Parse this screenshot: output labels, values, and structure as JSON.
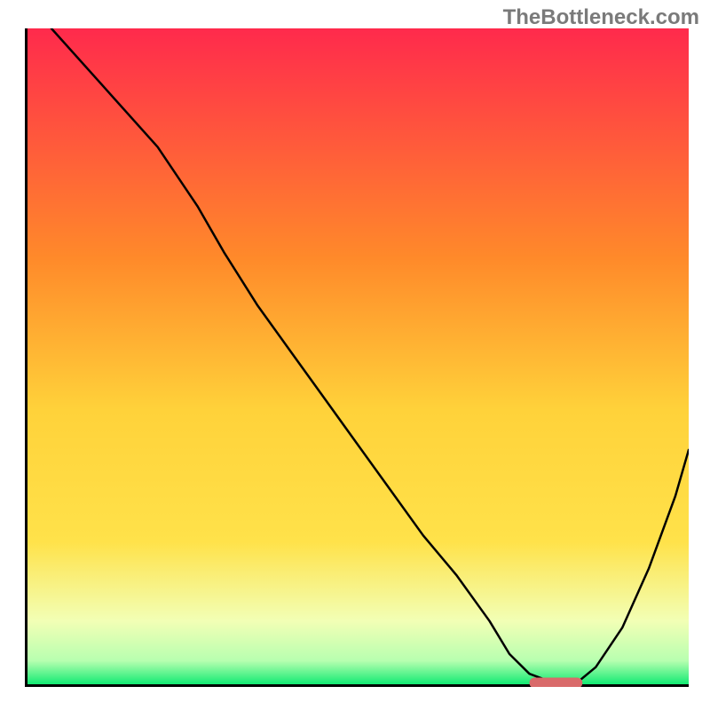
{
  "watermark": "TheBottleneck.com",
  "chart_data": {
    "type": "line",
    "title": "",
    "xlabel": "",
    "ylabel": "",
    "xlim": [
      0,
      100
    ],
    "ylim": [
      0,
      100
    ],
    "gradient_colors": {
      "top": "#ff2a4c",
      "mid_upper": "#ff9a2a",
      "mid": "#ffe24a",
      "mid_lower": "#f5ff8a",
      "band": "#d6ffb0",
      "bottom": "#00e86c"
    },
    "series": [
      {
        "name": "bottleneck-curve",
        "x": [
          4,
          12,
          20,
          26,
          30,
          35,
          40,
          45,
          50,
          55,
          60,
          65,
          70,
          73,
          76,
          80,
          83,
          86,
          90,
          94,
          98,
          100
        ],
        "y": [
          100,
          91,
          82,
          73,
          66,
          58,
          51,
          44,
          37,
          30,
          23,
          17,
          10,
          5,
          2,
          0.5,
          0.5,
          3,
          9,
          18,
          29,
          36
        ]
      }
    ],
    "marker": {
      "name": "optimal-range",
      "x_range": [
        76,
        84
      ],
      "y": 0.6,
      "color": "#d96a6a"
    }
  }
}
